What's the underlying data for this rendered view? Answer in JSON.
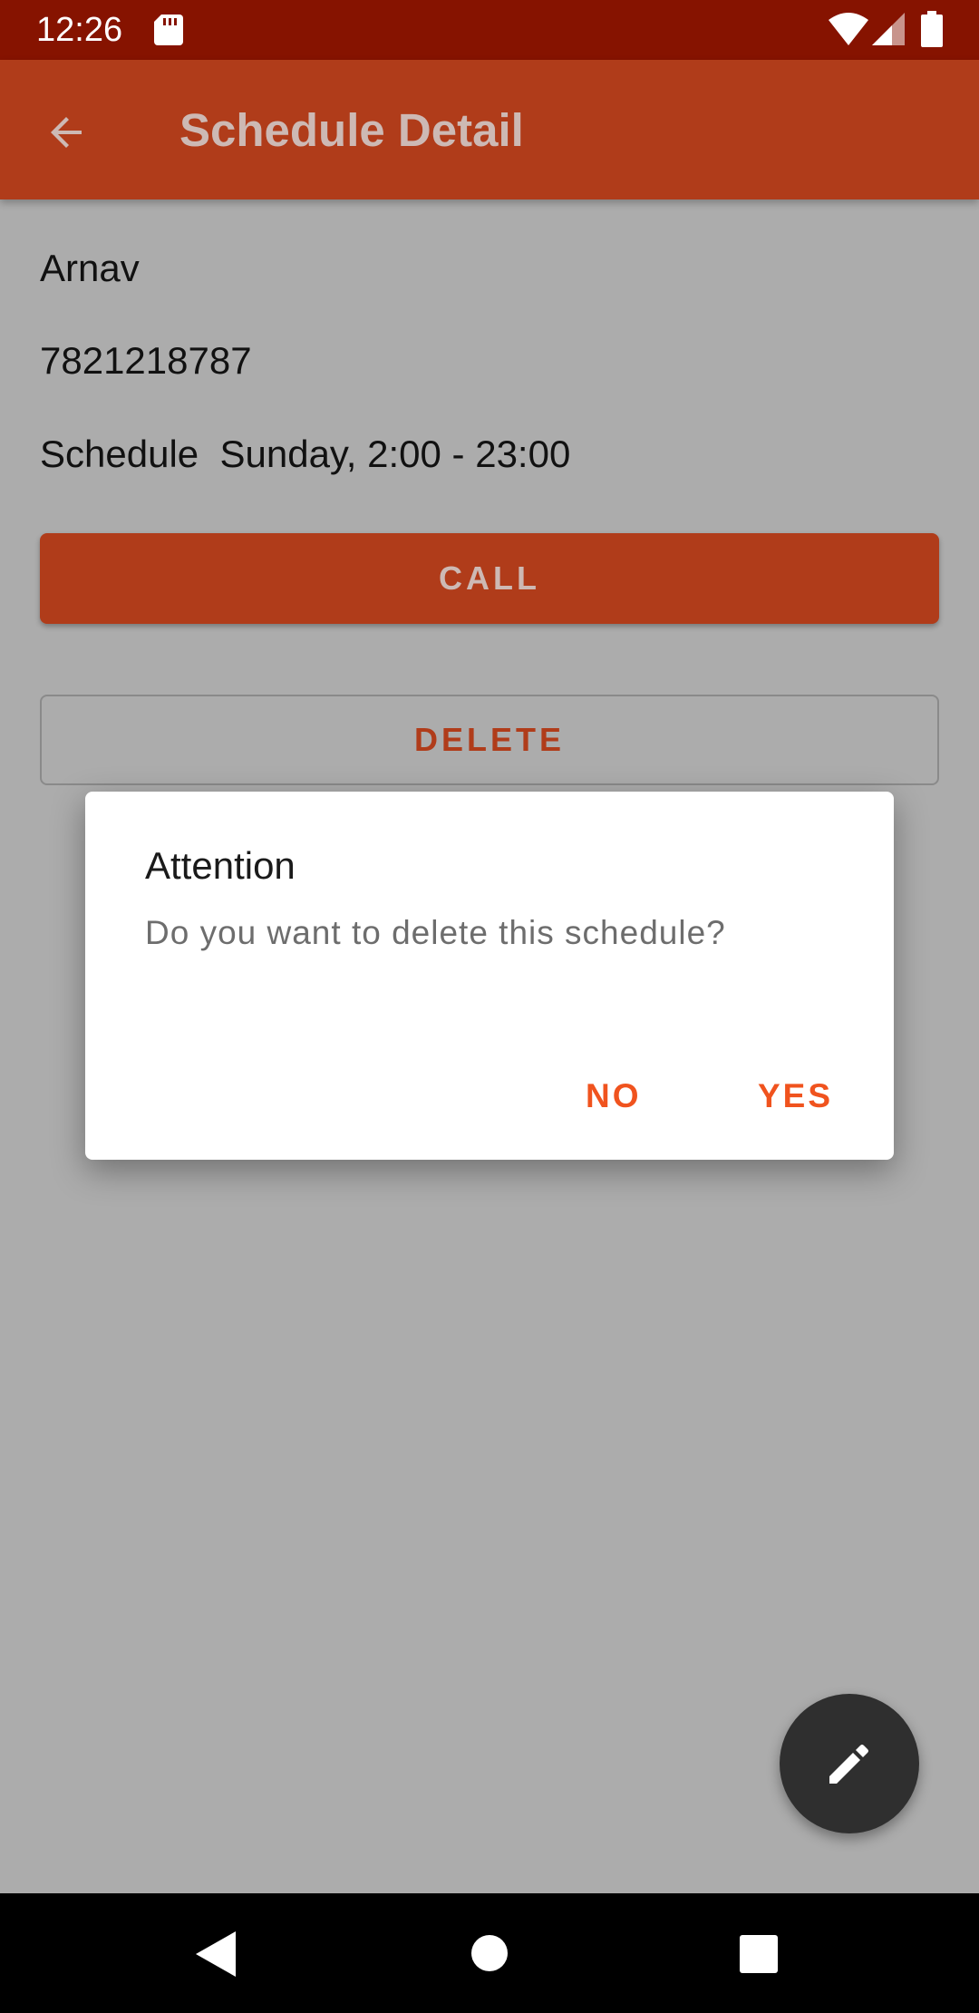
{
  "status_bar": {
    "time": "12:26"
  },
  "app_bar": {
    "title": "Schedule Detail"
  },
  "detail": {
    "name": "Arnav",
    "phone": "7821218787",
    "schedule": "Schedule  Sunday, 2:00 - 23:00"
  },
  "buttons": {
    "call": "CALL",
    "delete": "DELETE"
  },
  "dialog": {
    "title": "Attention",
    "message": "Do you want to delete this schedule?",
    "no": "NO",
    "yes": "YES"
  },
  "colors": {
    "status_bar": "#861300",
    "app_bar": "#b03c1a",
    "dialog_action": "#f0531e",
    "scrim_background": "#acacac",
    "fab": "#2f2f2f"
  },
  "icons": {
    "back": "arrow-left-icon",
    "fab": "pencil-icon",
    "status": [
      "sd-card-icon",
      "wifi-icon",
      "signal-icon",
      "battery-icon"
    ],
    "nav": [
      "nav-back-icon",
      "nav-home-icon",
      "nav-recents-icon"
    ]
  }
}
